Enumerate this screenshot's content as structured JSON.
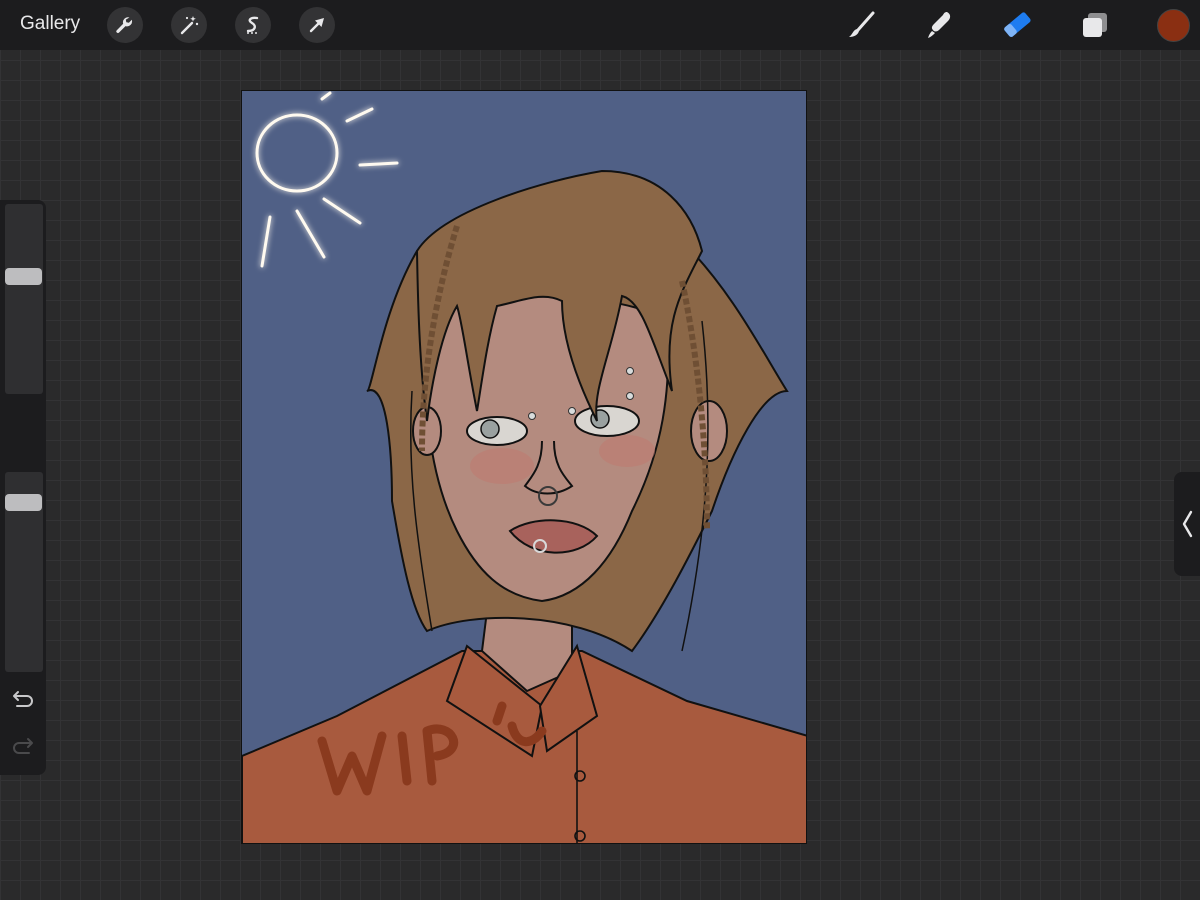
{
  "topbar": {
    "gallery_label": "Gallery",
    "left_tools": [
      "wrench-icon",
      "magic-wand-icon",
      "selection-icon",
      "transform-arrow-icon"
    ],
    "right_tools": [
      "brush-icon",
      "smudge-icon",
      "eraser-icon",
      "layers-icon"
    ],
    "active_tool": "eraser-icon",
    "current_color": "#8a2f12",
    "active_tool_color": "#1e7cf0"
  },
  "sidebar": {
    "brush_size_level": 0.63,
    "opacity_level": 0.88,
    "icons": [
      "modify-square-icon",
      "undo-icon",
      "redo-icon"
    ]
  },
  "canvas": {
    "background_color": "#506086",
    "shirt_color": "#a85a3e",
    "hair_color": "#8b6747",
    "skin_color": "#b48b7f"
  },
  "right_panel": {
    "collapse_icon": "chevron-left-icon"
  }
}
